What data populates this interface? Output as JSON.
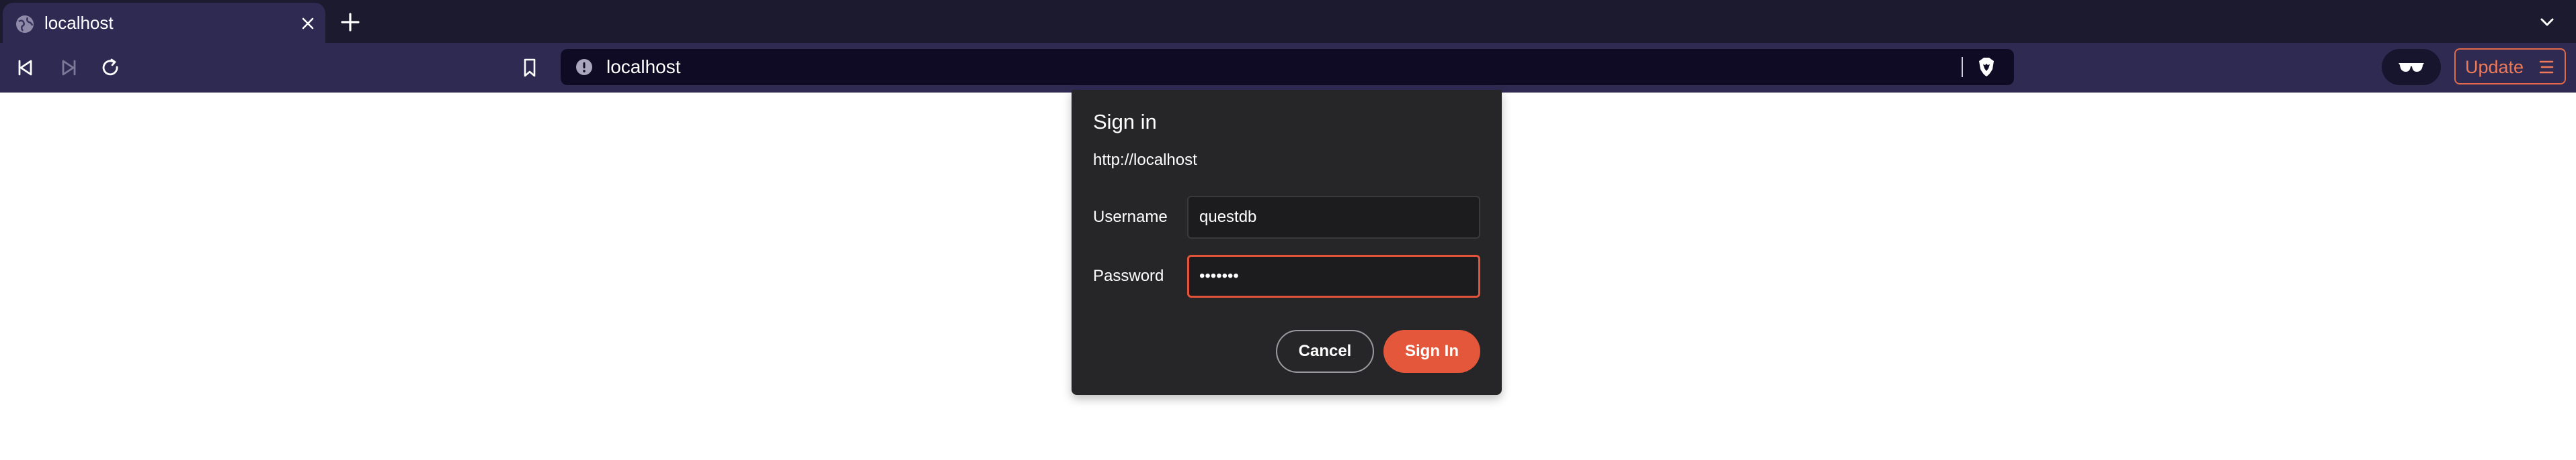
{
  "tab": {
    "title": "localhost",
    "favicon": "globe-icon"
  },
  "toolbar": {
    "url": "localhost",
    "update_label": "Update",
    "icons": [
      "back-icon",
      "forward-icon",
      "reload-icon",
      "bookmark-icon",
      "site-info-icon",
      "brave-shield-icon",
      "private-glasses-icon",
      "menu-icon"
    ]
  },
  "dialog": {
    "title": "Sign in",
    "origin": "http://localhost",
    "username_label": "Username",
    "username_value": "questdb",
    "password_label": "Password",
    "password_value": "•••••••",
    "cancel_label": "Cancel",
    "signin_label": "Sign In"
  },
  "colors": {
    "tabstrip": "#1b1a2e",
    "toolbar": "#2f2a52",
    "urlbar": "#0f0b24",
    "accent": "#e5573b",
    "dialog_bg": "#262628"
  }
}
